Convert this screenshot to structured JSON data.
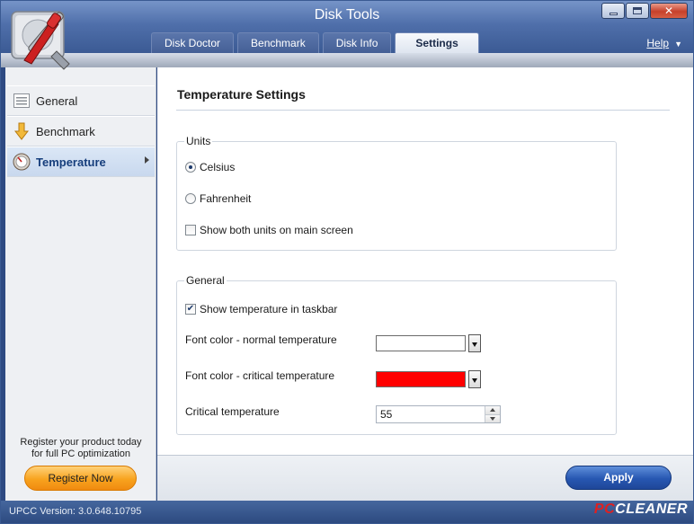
{
  "window": {
    "title": "Disk Tools"
  },
  "tabs": [
    {
      "label": "Disk Doctor",
      "active": false
    },
    {
      "label": "Benchmark",
      "active": false
    },
    {
      "label": "Disk Info",
      "active": false
    },
    {
      "label": "Settings",
      "active": true
    }
  ],
  "help": {
    "label": "Help"
  },
  "sidebar": {
    "items": [
      {
        "label": "General",
        "icon": "list-icon",
        "active": false
      },
      {
        "label": "Benchmark",
        "icon": "down-arrow-icon",
        "active": false
      },
      {
        "label": "Temperature",
        "icon": "gauge-icon",
        "active": true
      }
    ],
    "register_text_line1": "Register your product today",
    "register_text_line2": "for full PC optimization",
    "register_button": "Register Now"
  },
  "main": {
    "title": "Temperature Settings",
    "units_group": {
      "label": "Units",
      "celsius": {
        "label": "Celsius",
        "selected": true
      },
      "fahrenheit": {
        "label": "Fahrenheit",
        "selected": false
      },
      "show_both": {
        "label": "Show both units on main screen",
        "checked": false
      }
    },
    "general_group": {
      "label": "General",
      "show_taskbar": {
        "label": "Show temperature in taskbar",
        "checked": true
      },
      "font_normal_label": "Font color - normal temperature",
      "font_normal_color": "#ffffff",
      "font_critical_label": "Font color - critical temperature",
      "font_critical_color": "#ff0000",
      "critical_temp_label": "Critical temperature",
      "critical_temp_value": "55"
    },
    "apply_button": "Apply"
  },
  "status": {
    "version": "UPCC Version: 3.0.648.10795"
  },
  "brand": {
    "pc": "PC",
    "cleaner": "CLEANER"
  },
  "colors": {
    "accent": "#2757b1",
    "register": "#f8a31e",
    "titlebar": "#4f6faa"
  }
}
